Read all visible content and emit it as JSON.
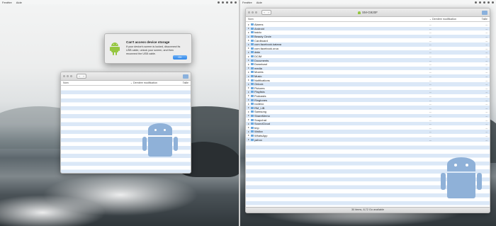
{
  "menubar": {
    "app_name": "Fenêtre",
    "help": "Aide"
  },
  "columns": {
    "name": "Nom",
    "date": "Dernière modification",
    "size": "Taille"
  },
  "alert": {
    "title": "Can't access device storage",
    "message": "If your device's screen is locked, disconnect its USB cable, unlock your screen, and then reconnect the USB cable.",
    "ok_label": "OK"
  },
  "device_window": {
    "title": "SM-G920F",
    "status": "30 items, 8,72 Go available",
    "items": [
      {
        "name": "Alarms",
        "date": "--",
        "size": "--"
      },
      {
        "name": "Android",
        "date": "--",
        "size": "--"
      },
      {
        "name": "baidu",
        "date": "--",
        "size": "--"
      },
      {
        "name": "Beauty Circle",
        "date": "--",
        "size": "--"
      },
      {
        "name": "Cardboard",
        "date": "--",
        "size": "--"
      },
      {
        "name": "com.facebook.katana",
        "date": "--",
        "size": "--"
      },
      {
        "name": "com.facebook.orca",
        "date": "--",
        "size": "--"
      },
      {
        "name": "data",
        "date": "--",
        "size": "--"
      },
      {
        "name": "DCIM",
        "date": "--",
        "size": "--"
      },
      {
        "name": "Documents",
        "date": "--",
        "size": "--"
      },
      {
        "name": "Download",
        "date": "--",
        "size": "--"
      },
      {
        "name": "media",
        "date": "--",
        "size": "--"
      },
      {
        "name": "Movies",
        "date": "--",
        "size": "--"
      },
      {
        "name": "Music",
        "date": "--",
        "size": "--"
      },
      {
        "name": "Notifications",
        "date": "--",
        "size": "--"
      },
      {
        "name": "Onlock",
        "date": "--",
        "size": "--"
      },
      {
        "name": "Pictures",
        "date": "--",
        "size": "--"
      },
      {
        "name": "Playlists",
        "date": "--",
        "size": "--"
      },
      {
        "name": "Podcasts",
        "date": "--",
        "size": "--"
      },
      {
        "name": "Ringtones",
        "date": "--",
        "size": "--"
      },
      {
        "name": "rootexo",
        "date": "--",
        "size": "--"
      },
      {
        "name": "RM_LIB",
        "date": "--",
        "size": "--"
      },
      {
        "name": "Samsung",
        "date": "--",
        "size": "--"
      },
      {
        "name": "ShareMemo",
        "date": "--",
        "size": "--"
      },
      {
        "name": "Snapchat",
        "date": "--",
        "size": "--"
      },
      {
        "name": "SoundCloud",
        "date": "--",
        "size": "--"
      },
      {
        "name": "tmp",
        "date": "--",
        "size": "--"
      },
      {
        "name": "Wallox",
        "date": "--",
        "size": "--"
      },
      {
        "name": "WhatsApp",
        "date": "--",
        "size": "--"
      },
      {
        "name": "yahoo",
        "date": "--",
        "size": "--"
      }
    ]
  }
}
